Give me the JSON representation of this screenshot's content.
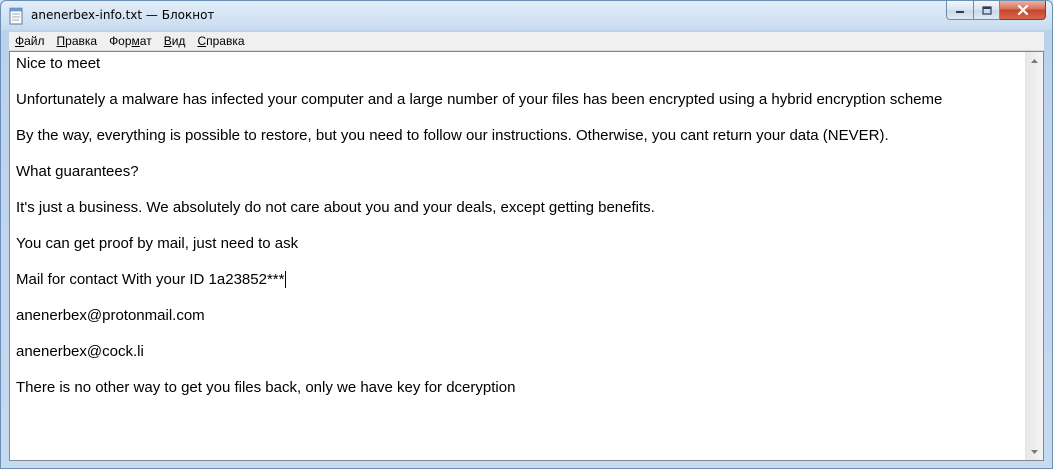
{
  "window": {
    "title": "anenerbex-info.txt — Блокнот"
  },
  "menu": {
    "file": {
      "first": "Ф",
      "rest": "айл"
    },
    "edit": {
      "first": "П",
      "rest": "равка"
    },
    "format": {
      "pre": "Фор",
      "first": "м",
      "rest": "ат"
    },
    "view": {
      "first": "В",
      "rest": "ид"
    },
    "help": {
      "first": "С",
      "rest": "правка"
    }
  },
  "document": {
    "lines": [
      "Nice to meet",
      "",
      "Unfortunately a malware has infected your computer and a large number of your files has been encrypted using a hybrid encryption scheme",
      "",
      "By the way, everything is possible to restore, but you need to follow our instructions. Otherwise, you cant return your data (NEVER).",
      "",
      "What guarantees?",
      "",
      "It's just a business. We absolutely do not care about you and your deals, except getting benefits.",
      "",
      "You can get proof by mail, just need to ask",
      "",
      "Mail for contact With your ID 1a23852***",
      "",
      "anenerbex@protonmail.com",
      "",
      "anenerbex@cock.li",
      "",
      "There is no other way to get you files back, only we have key for dceryption"
    ]
  }
}
